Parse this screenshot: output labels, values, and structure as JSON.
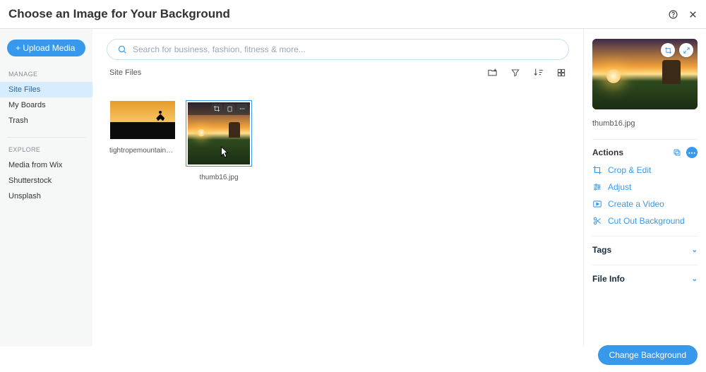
{
  "header": {
    "title": "Choose an Image for Your Background"
  },
  "sidebar": {
    "upload_label": "+ Upload Media",
    "manage_label": "MANAGE",
    "explore_label": "EXPLORE",
    "manage_items": [
      "Site Files",
      "My Boards",
      "Trash"
    ],
    "explore_items": [
      "Media from Wix",
      "Shutterstock",
      "Unsplash"
    ]
  },
  "search": {
    "placeholder": "Search for business, fashion, fitness & more..."
  },
  "breadcrumb": "Site Files",
  "files": [
    {
      "name": "tightropemountains.jpg"
    },
    {
      "name": "thumb16.jpg"
    }
  ],
  "rightPanel": {
    "filename": "thumb16.jpg",
    "actions_label": "Actions",
    "actions": [
      "Crop & Edit",
      "Adjust",
      "Create a Video",
      "Cut Out Background"
    ],
    "tags_label": "Tags",
    "fileinfo_label": "File Info"
  },
  "footer": {
    "change_bg": "Change Background"
  }
}
